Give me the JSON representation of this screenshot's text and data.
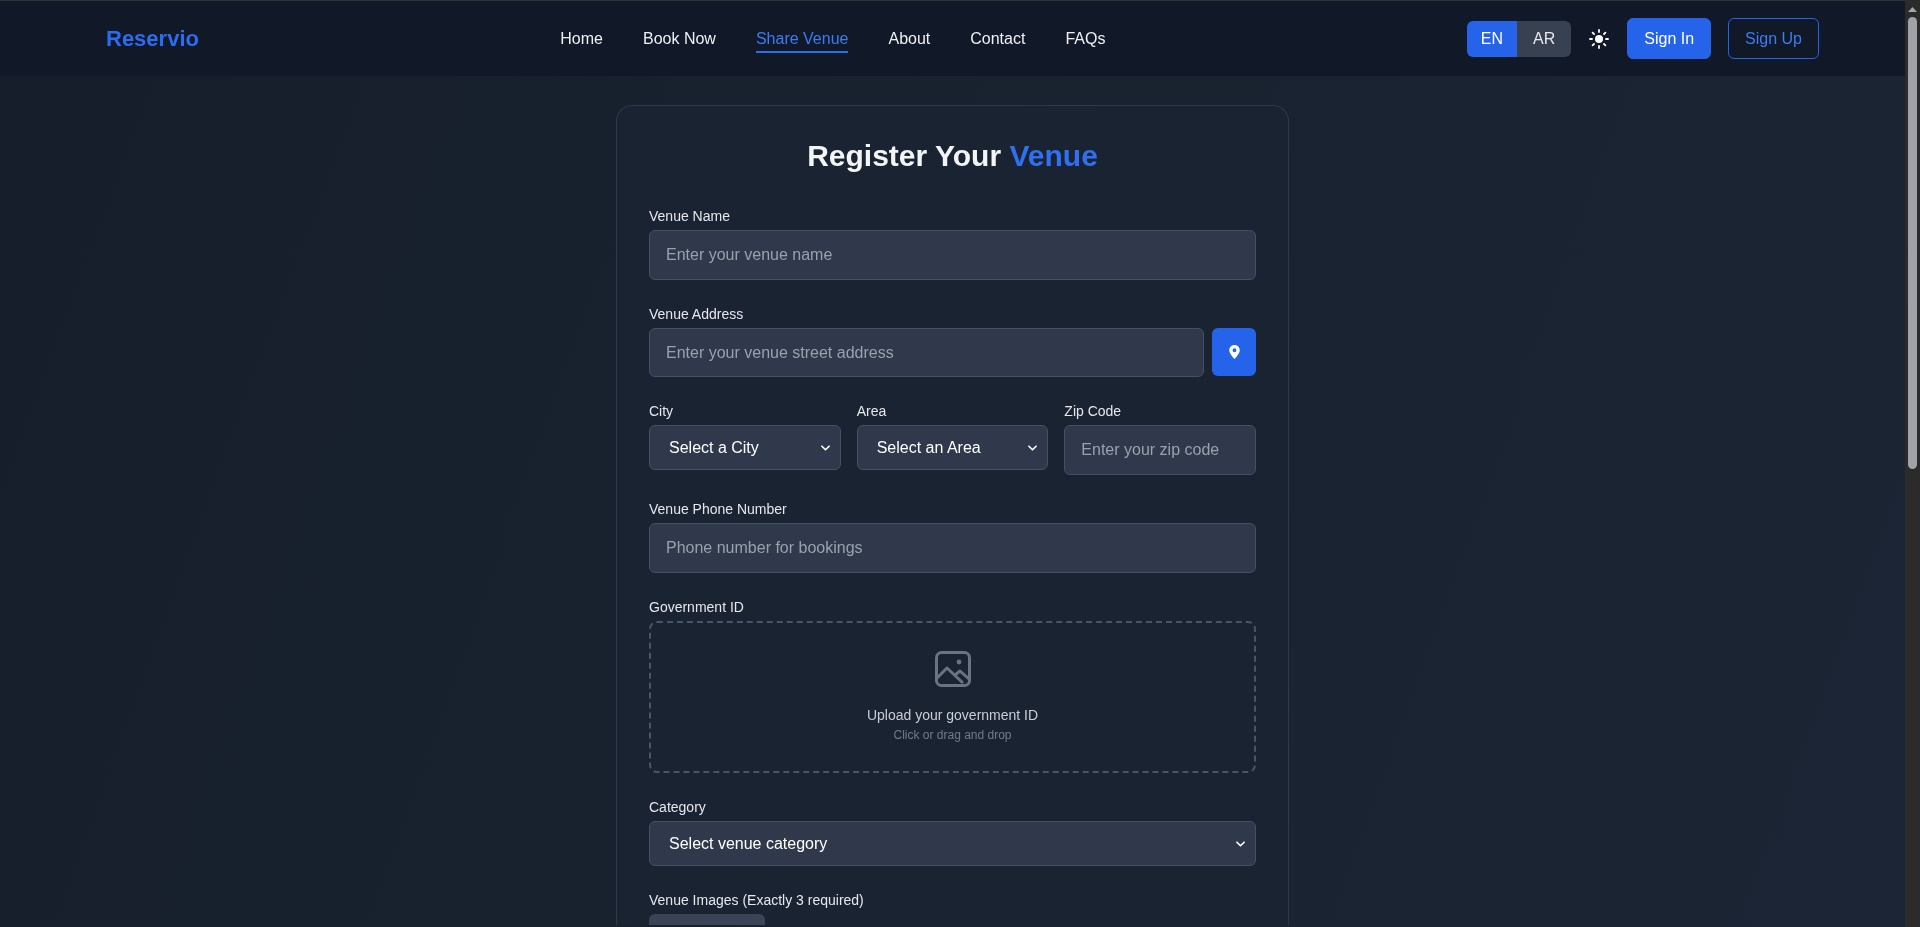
{
  "header": {
    "logo": "Reservio",
    "nav": [
      {
        "label": "Home",
        "selected": false
      },
      {
        "label": "Book Now",
        "selected": false
      },
      {
        "label": "Share Venue",
        "selected": true
      },
      {
        "label": "About",
        "selected": false
      },
      {
        "label": "Contact",
        "selected": false
      },
      {
        "label": "FAQs",
        "selected": false
      }
    ],
    "languages": [
      {
        "label": "EN",
        "selected": true
      },
      {
        "label": "AR",
        "selected": false
      }
    ],
    "sign_in": "Sign In",
    "sign_up": "Sign Up"
  },
  "form": {
    "title": "Register Your",
    "title_highlight": "Venue",
    "fields": [
      {
        "kind": "text",
        "label": "Venue Name",
        "placeholder": "Enter your venue name"
      },
      {
        "kind": "address",
        "label": "Venue Address",
        "placeholder": "Enter your venue street address"
      },
      {
        "kind": "row",
        "fields": [
          {
            "kind": "select",
            "label": "City",
            "value": "Select a City"
          },
          {
            "kind": "select",
            "label": "Area",
            "value": "Select an Area"
          },
          {
            "kind": "text",
            "label": "Zip Code",
            "placeholder": "Enter your zip code"
          }
        ]
      },
      {
        "kind": "text",
        "label": "Venue Phone Number",
        "placeholder": "Phone number for bookings"
      },
      {
        "kind": "upload",
        "label": "Government ID",
        "title": "Upload your government ID",
        "hint": "Click or drag and drop"
      },
      {
        "kind": "select",
        "label": "Category",
        "value": "Select venue category"
      },
      {
        "kind": "images",
        "label": "Venue Images (Exactly 3 required)"
      }
    ]
  }
}
